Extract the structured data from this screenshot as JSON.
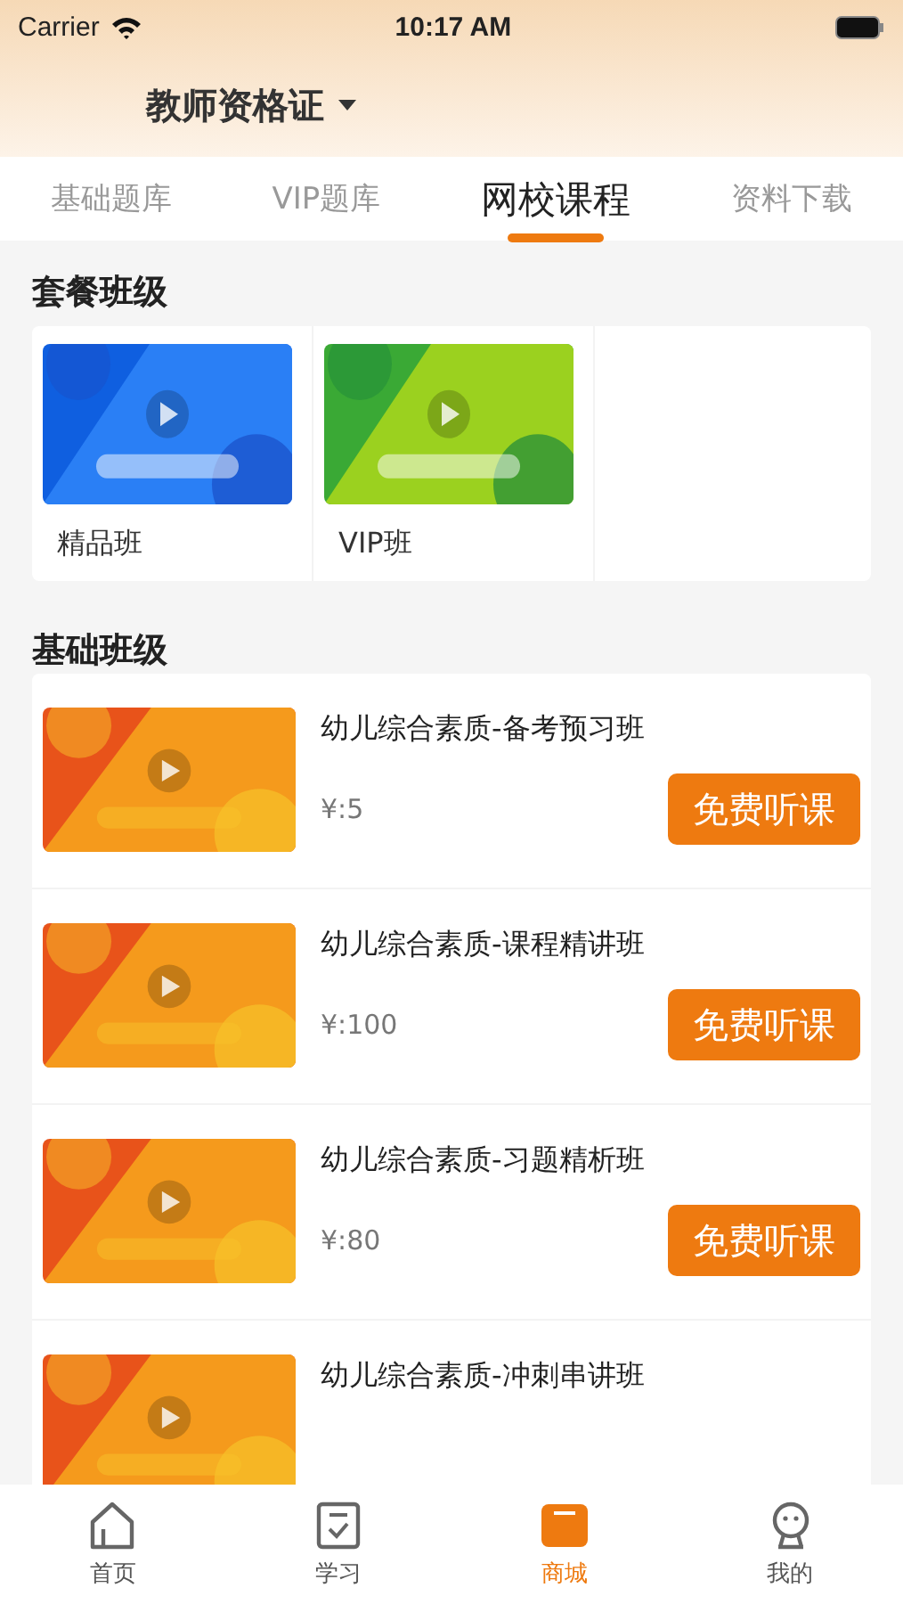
{
  "status_bar": {
    "carrier": "Carrier",
    "time": "10:17 AM"
  },
  "header": {
    "title": "教师资格证"
  },
  "tabs": [
    {
      "label": "基础题库",
      "selected": false
    },
    {
      "label": "VIP题库",
      "selected": false
    },
    {
      "label": "网校课程",
      "selected": true
    },
    {
      "label": "资料下载",
      "selected": false
    }
  ],
  "package_section": {
    "title": "套餐班级",
    "items": [
      {
        "name": "精品班"
      },
      {
        "name": "VIP班"
      }
    ]
  },
  "basic_section": {
    "title": "基础班级",
    "courses": [
      {
        "title": "幼儿综合素质-备考预习班",
        "price": "¥:5",
        "button": "免费听课"
      },
      {
        "title": "幼儿综合素质-课程精讲班",
        "price": "¥:100",
        "button": "免费听课"
      },
      {
        "title": "幼儿综合素质-习题精析班",
        "price": "¥:80",
        "button": "免费听课"
      },
      {
        "title": "幼儿综合素质-冲刺串讲班"
      }
    ]
  },
  "tab_bar": [
    {
      "label": "首页",
      "selected": false
    },
    {
      "label": "学习",
      "selected": false
    },
    {
      "label": "商城",
      "selected": true
    },
    {
      "label": "我的",
      "selected": false
    }
  ]
}
